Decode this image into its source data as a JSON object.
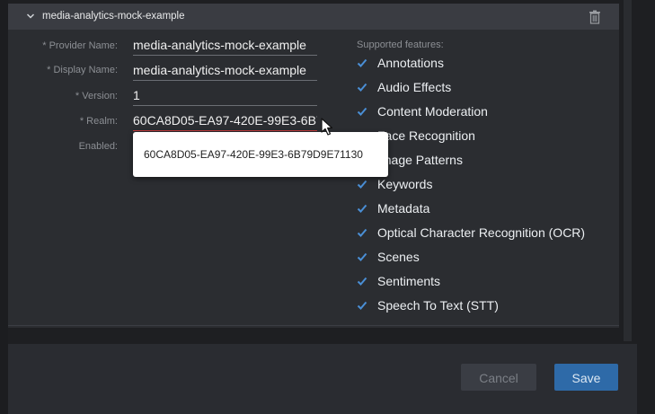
{
  "panel": {
    "title": "media-analytics-mock-example"
  },
  "fields": {
    "provider_name_label": "* Provider Name:",
    "provider_name_value": "media-analytics-mock-example",
    "display_name_label": "* Display Name:",
    "display_name_value": "media-analytics-mock-example",
    "version_label": "* Version:",
    "version_value": "1",
    "realm_label": "* Realm:",
    "realm_value": "60CA8D05-EA97-420E-99E3-6B79D9E71130",
    "enabled_label": "Enabled:"
  },
  "tooltip": {
    "text": "60CA8D05-EA97-420E-99E3-6B79D9E71130"
  },
  "features": {
    "title": "Supported features:",
    "items": [
      {
        "label": "Annotations",
        "checked": true
      },
      {
        "label": "Audio Effects",
        "checked": true
      },
      {
        "label": "Content Moderation",
        "checked": true
      },
      {
        "label": "Face Recognition",
        "checked": true
      },
      {
        "label": "Image Patterns",
        "checked": true
      },
      {
        "label": "Keywords",
        "checked": true
      },
      {
        "label": "Metadata",
        "checked": true
      },
      {
        "label": "Optical Character Recognition (OCR)",
        "checked": true
      },
      {
        "label": "Scenes",
        "checked": true
      },
      {
        "label": "Sentiments",
        "checked": true
      },
      {
        "label": "Speech To Text (STT)",
        "checked": true
      }
    ]
  },
  "footer": {
    "cancel_label": "Cancel",
    "save_label": "Save"
  },
  "colors": {
    "check": "#4a8fd6",
    "accent": "#2e6aa8",
    "invalid_underline": "#c03a3a"
  }
}
